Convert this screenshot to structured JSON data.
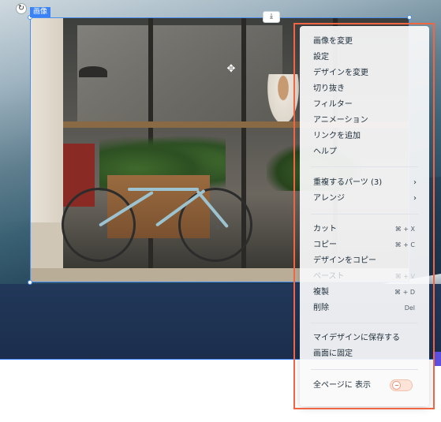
{
  "element": {
    "label": "画像",
    "rotate_icon": "rotate-icon",
    "download_icon": "download-icon",
    "move_icon": "move-icon",
    "download_glyph": "⤓",
    "rotate_glyph": "↻",
    "move_glyph": "✥"
  },
  "menu": {
    "group1": [
      {
        "label": "画像を変更"
      },
      {
        "label": "設定"
      },
      {
        "label": "デザインを変更"
      },
      {
        "label": "切り抜き"
      },
      {
        "label": "フィルター"
      },
      {
        "label": "アニメーション"
      },
      {
        "label": "リンクを追加"
      },
      {
        "label": "ヘルプ"
      }
    ],
    "group2": [
      {
        "label": "重複するパーツ (3)",
        "arrow": "›"
      },
      {
        "label": "アレンジ",
        "arrow": "›"
      }
    ],
    "group3": [
      {
        "label": "カット",
        "shortcut": "⌘ + X",
        "disabled": false
      },
      {
        "label": "コピー",
        "shortcut": "⌘ + C",
        "disabled": false
      },
      {
        "label": "デザインをコピー",
        "shortcut": "",
        "disabled": false
      },
      {
        "label": "ペースト",
        "shortcut": "⌘ + V",
        "disabled": true
      },
      {
        "label": "複製",
        "shortcut": "⌘ + D",
        "disabled": false
      },
      {
        "label": "削除",
        "shortcut": "Del",
        "disabled": false
      }
    ],
    "group4": [
      {
        "label": "マイデザインに保存する"
      },
      {
        "label": "画面に固定"
      }
    ],
    "show_all_pages": {
      "label": "全ページに 表示",
      "enabled": false
    }
  },
  "colors": {
    "accent": "#3b82f6",
    "highlight_border": "#f06543",
    "toggle_bg": "#fde3d8"
  }
}
